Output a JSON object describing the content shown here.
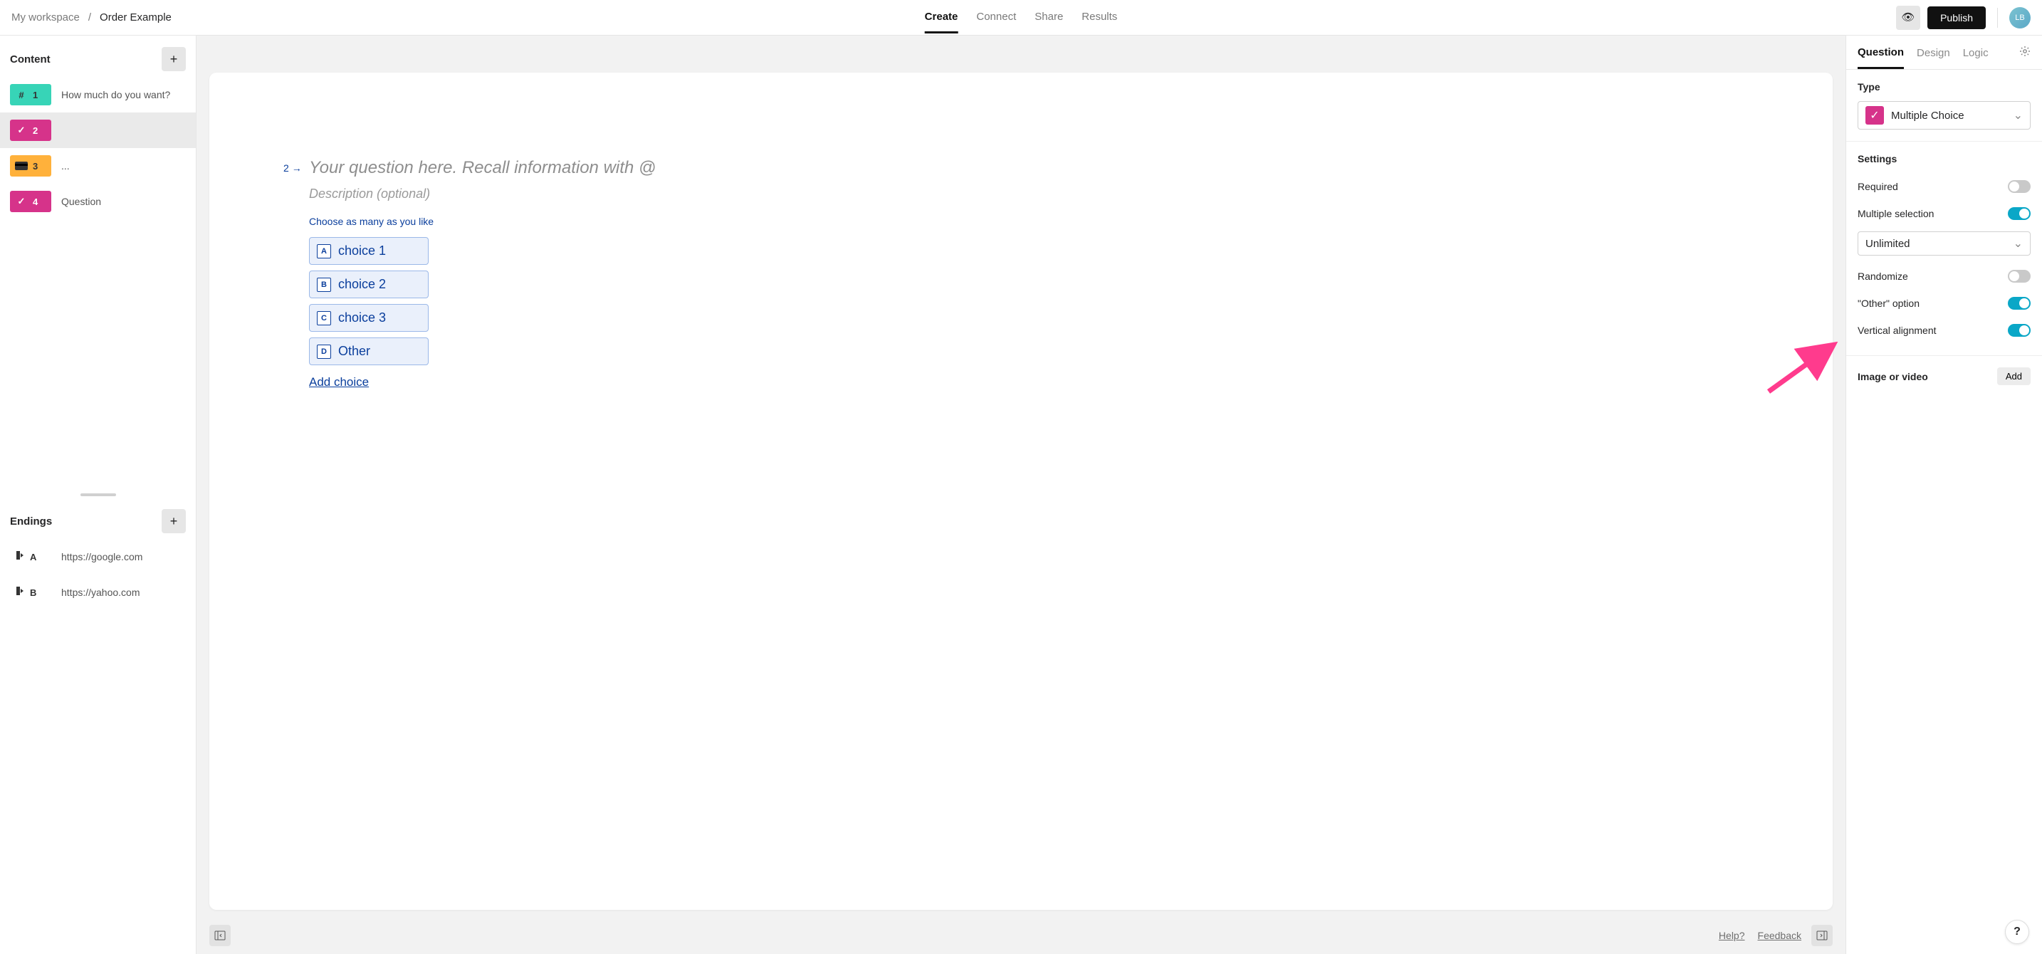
{
  "breadcrumb": {
    "workspace": "My workspace",
    "sep": "/",
    "form": "Order Example"
  },
  "top_tabs": {
    "create": "Create",
    "connect": "Connect",
    "share": "Share",
    "results": "Results"
  },
  "publish_label": "Publish",
  "avatar_initials": "LB",
  "sidebar": {
    "content_header": "Content",
    "endings_header": "Endings",
    "items": [
      {
        "num": "1",
        "label": "How much do you want?"
      },
      {
        "num": "2",
        "label": ""
      },
      {
        "num": "3",
        "label": "..."
      },
      {
        "num": "4",
        "label": "Question"
      }
    ],
    "endings": [
      {
        "letter": "A",
        "label": "https://google.com"
      },
      {
        "letter": "B",
        "label": "https://yahoo.com"
      }
    ]
  },
  "canvas": {
    "qnum": "2",
    "arrow": "→",
    "title_placeholder": "Your question here. Recall information with @",
    "desc_placeholder": "Description (optional)",
    "hint": "Choose as many as you like",
    "choices": [
      {
        "key": "A",
        "text": "choice 1"
      },
      {
        "key": "B",
        "text": "choice 2"
      },
      {
        "key": "C",
        "text": "choice 3"
      },
      {
        "key": "D",
        "text": "Other"
      }
    ],
    "add_choice": "Add choice",
    "footer": {
      "help": "Help?",
      "feedback": "Feedback"
    }
  },
  "right": {
    "tabs": {
      "question": "Question",
      "design": "Design",
      "logic": "Logic"
    },
    "type_label": "Type",
    "type_value": "Multiple Choice",
    "settings_label": "Settings",
    "settings": {
      "required": "Required",
      "multiple_selection": "Multiple selection",
      "selection_limit": "Unlimited",
      "randomize": "Randomize",
      "other_option": "\"Other\" option",
      "vertical_alignment": "Vertical alignment"
    },
    "media_label": "Image or video",
    "add_label": "Add"
  },
  "help_fab": "?"
}
